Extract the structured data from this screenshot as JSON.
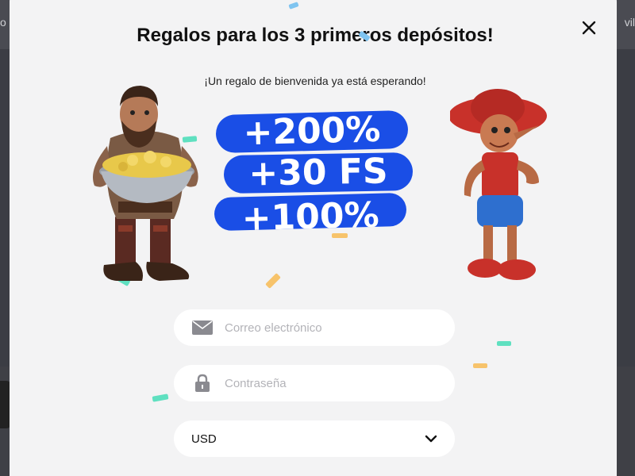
{
  "background": {
    "left_text": "o",
    "right_text": "vil"
  },
  "modal": {
    "title": "Regalos para los 3 primeros depósitos!",
    "subtitle": "¡Un regalo de bienvenida ya está esperando!",
    "close_icon": "close-icon",
    "bonuses": [
      "+200%",
      "+30 FS",
      "+100%"
    ],
    "form": {
      "email_placeholder": "Correo electrónico",
      "email_icon": "envelope-icon",
      "password_placeholder": "Contraseña",
      "password_icon": "lock-icon",
      "currency_value": "USD",
      "currency_icon": "chevron-down-icon"
    }
  },
  "colors": {
    "accent": "#1a4ee6",
    "modal_bg": "#f3f3f4",
    "confetti_teal": "#5fe0c0",
    "confetti_orange": "#f7c36b",
    "confetti_blue": "#7fc4f0"
  }
}
